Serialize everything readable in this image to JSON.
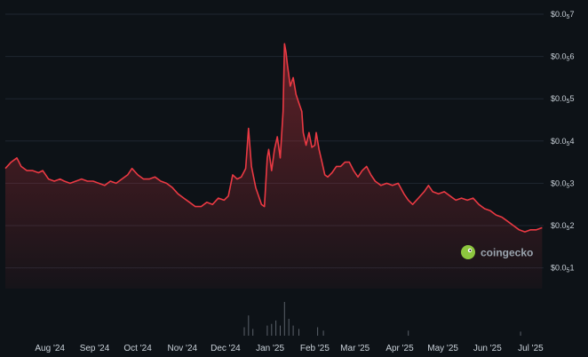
{
  "chart_data": {
    "type": "area",
    "x_start": "2024-07-01",
    "x_end": "2025-07-10",
    "x_ticks": [
      {
        "date": "2024-08-01",
        "label": "Aug '24"
      },
      {
        "date": "2024-09-01",
        "label": "Sep '24"
      },
      {
        "date": "2024-10-01",
        "label": "Oct '24"
      },
      {
        "date": "2024-11-01",
        "label": "Nov '24"
      },
      {
        "date": "2024-12-01",
        "label": "Dec '24"
      },
      {
        "date": "2025-01-01",
        "label": "Jan '25"
      },
      {
        "date": "2025-02-01",
        "label": "Feb '25"
      },
      {
        "date": "2025-03-01",
        "label": "Mar '25"
      },
      {
        "date": "2025-04-01",
        "label": "Apr '25"
      },
      {
        "date": "2025-05-01",
        "label": "May '25"
      },
      {
        "date": "2025-06-01",
        "label": "Jun '25"
      },
      {
        "date": "2025-07-01",
        "label": "Jul '25"
      }
    ],
    "ylim": [
      1,
      7
    ],
    "y_ticks": [
      {
        "value": 7,
        "prefix": "$0.0",
        "sub": "5",
        "digit": "7"
      },
      {
        "value": 6,
        "prefix": "$0.0",
        "sub": "5",
        "digit": "6"
      },
      {
        "value": 5,
        "prefix": "$0.0",
        "sub": "5",
        "digit": "5"
      },
      {
        "value": 4,
        "prefix": "$0.0",
        "sub": "5",
        "digit": "4"
      },
      {
        "value": 3,
        "prefix": "$0.0",
        "sub": "5",
        "digit": "3"
      },
      {
        "value": 2,
        "prefix": "$0.0",
        "sub": "5",
        "digit": "2"
      },
      {
        "value": 1,
        "prefix": "$0.0",
        "sub": "5",
        "digit": "1"
      }
    ],
    "series": [
      {
        "color": "#ea3943",
        "points": [
          [
            "2024-07-01",
            3.35
          ],
          [
            "2024-07-05",
            3.5
          ],
          [
            "2024-07-09",
            3.6
          ],
          [
            "2024-07-12",
            3.4
          ],
          [
            "2024-07-16",
            3.3
          ],
          [
            "2024-07-20",
            3.3
          ],
          [
            "2024-07-24",
            3.25
          ],
          [
            "2024-07-27",
            3.3
          ],
          [
            "2024-07-31",
            3.1
          ],
          [
            "2024-08-04",
            3.05
          ],
          [
            "2024-08-08",
            3.1
          ],
          [
            "2024-08-11",
            3.05
          ],
          [
            "2024-08-15",
            3.0
          ],
          [
            "2024-08-19",
            3.05
          ],
          [
            "2024-08-23",
            3.1
          ],
          [
            "2024-08-27",
            3.05
          ],
          [
            "2024-08-31",
            3.05
          ],
          [
            "2024-09-04",
            3.0
          ],
          [
            "2024-09-08",
            2.95
          ],
          [
            "2024-09-12",
            3.05
          ],
          [
            "2024-09-16",
            3.0
          ],
          [
            "2024-09-20",
            3.1
          ],
          [
            "2024-09-24",
            3.2
          ],
          [
            "2024-09-27",
            3.35
          ],
          [
            "2024-10-01",
            3.2
          ],
          [
            "2024-10-05",
            3.1
          ],
          [
            "2024-10-09",
            3.1
          ],
          [
            "2024-10-13",
            3.15
          ],
          [
            "2024-10-17",
            3.05
          ],
          [
            "2024-10-21",
            3.0
          ],
          [
            "2024-10-25",
            2.9
          ],
          [
            "2024-10-29",
            2.75
          ],
          [
            "2024-11-02",
            2.65
          ],
          [
            "2024-11-06",
            2.55
          ],
          [
            "2024-11-10",
            2.45
          ],
          [
            "2024-11-14",
            2.45
          ],
          [
            "2024-11-18",
            2.55
          ],
          [
            "2024-11-22",
            2.5
          ],
          [
            "2024-11-26",
            2.65
          ],
          [
            "2024-11-30",
            2.6
          ],
          [
            "2024-12-03",
            2.7
          ],
          [
            "2024-12-06",
            3.2
          ],
          [
            "2024-12-09",
            3.1
          ],
          [
            "2024-12-12",
            3.15
          ],
          [
            "2024-12-15",
            3.35
          ],
          [
            "2024-12-17",
            4.3
          ],
          [
            "2024-12-19",
            3.4
          ],
          [
            "2024-12-22",
            2.9
          ],
          [
            "2024-12-26",
            2.5
          ],
          [
            "2024-12-28",
            2.45
          ],
          [
            "2024-12-30",
            3.6
          ],
          [
            "2024-12-31",
            3.8
          ],
          [
            "2025-01-02",
            3.3
          ],
          [
            "2025-01-04",
            3.8
          ],
          [
            "2025-01-06",
            4.1
          ],
          [
            "2025-01-08",
            3.6
          ],
          [
            "2025-01-10",
            4.7
          ],
          [
            "2025-01-11",
            6.3
          ],
          [
            "2025-01-12",
            6.1
          ],
          [
            "2025-01-13",
            5.8
          ],
          [
            "2025-01-15",
            5.3
          ],
          [
            "2025-01-17",
            5.5
          ],
          [
            "2025-01-19",
            5.1
          ],
          [
            "2025-01-21",
            4.9
          ],
          [
            "2025-01-23",
            4.7
          ],
          [
            "2025-01-24",
            4.2
          ],
          [
            "2025-01-26",
            3.9
          ],
          [
            "2025-01-28",
            4.2
          ],
          [
            "2025-01-30",
            3.85
          ],
          [
            "2025-02-01",
            3.9
          ],
          [
            "2025-02-02",
            4.2
          ],
          [
            "2025-02-04",
            3.8
          ],
          [
            "2025-02-06",
            3.5
          ],
          [
            "2025-02-08",
            3.2
          ],
          [
            "2025-02-10",
            3.15
          ],
          [
            "2025-02-13",
            3.25
          ],
          [
            "2025-02-16",
            3.4
          ],
          [
            "2025-02-19",
            3.4
          ],
          [
            "2025-02-22",
            3.5
          ],
          [
            "2025-02-25",
            3.5
          ],
          [
            "2025-02-28",
            3.3
          ],
          [
            "2025-03-03",
            3.15
          ],
          [
            "2025-03-06",
            3.3
          ],
          [
            "2025-03-09",
            3.4
          ],
          [
            "2025-03-12",
            3.2
          ],
          [
            "2025-03-15",
            3.05
          ],
          [
            "2025-03-19",
            2.95
          ],
          [
            "2025-03-23",
            3.0
          ],
          [
            "2025-03-27",
            2.95
          ],
          [
            "2025-03-31",
            3.0
          ],
          [
            "2025-04-04",
            2.75
          ],
          [
            "2025-04-07",
            2.6
          ],
          [
            "2025-04-10",
            2.5
          ],
          [
            "2025-04-14",
            2.65
          ],
          [
            "2025-04-18",
            2.8
          ],
          [
            "2025-04-21",
            2.95
          ],
          [
            "2025-04-24",
            2.8
          ],
          [
            "2025-04-28",
            2.75
          ],
          [
            "2025-05-02",
            2.8
          ],
          [
            "2025-05-06",
            2.7
          ],
          [
            "2025-05-10",
            2.6
          ],
          [
            "2025-05-14",
            2.65
          ],
          [
            "2025-05-18",
            2.6
          ],
          [
            "2025-05-22",
            2.65
          ],
          [
            "2025-05-26",
            2.5
          ],
          [
            "2025-05-30",
            2.4
          ],
          [
            "2025-06-03",
            2.35
          ],
          [
            "2025-06-07",
            2.25
          ],
          [
            "2025-06-11",
            2.2
          ],
          [
            "2025-06-15",
            2.1
          ],
          [
            "2025-06-19",
            2.0
          ],
          [
            "2025-06-23",
            1.9
          ],
          [
            "2025-06-27",
            1.85
          ],
          [
            "2025-07-01",
            1.9
          ],
          [
            "2025-07-05",
            1.9
          ],
          [
            "2025-07-09",
            1.95
          ]
        ]
      }
    ],
    "volume": [
      [
        "2024-12-14",
        0.25
      ],
      [
        "2024-12-17",
        0.6
      ],
      [
        "2024-12-20",
        0.2
      ],
      [
        "2024-12-30",
        0.3
      ],
      [
        "2025-01-02",
        0.35
      ],
      [
        "2025-01-05",
        0.45
      ],
      [
        "2025-01-08",
        0.3
      ],
      [
        "2025-01-11",
        1.0
      ],
      [
        "2025-01-14",
        0.5
      ],
      [
        "2025-01-17",
        0.3
      ],
      [
        "2025-01-21",
        0.2
      ],
      [
        "2025-02-03",
        0.25
      ],
      [
        "2025-02-07",
        0.15
      ],
      [
        "2025-04-07",
        0.15
      ],
      [
        "2025-06-24",
        0.12
      ]
    ],
    "legend": "none",
    "grid": true
  },
  "watermark": {
    "text": "coingecko",
    "icon": "gecko-logo-icon",
    "icon_color": "#8dc63f"
  }
}
